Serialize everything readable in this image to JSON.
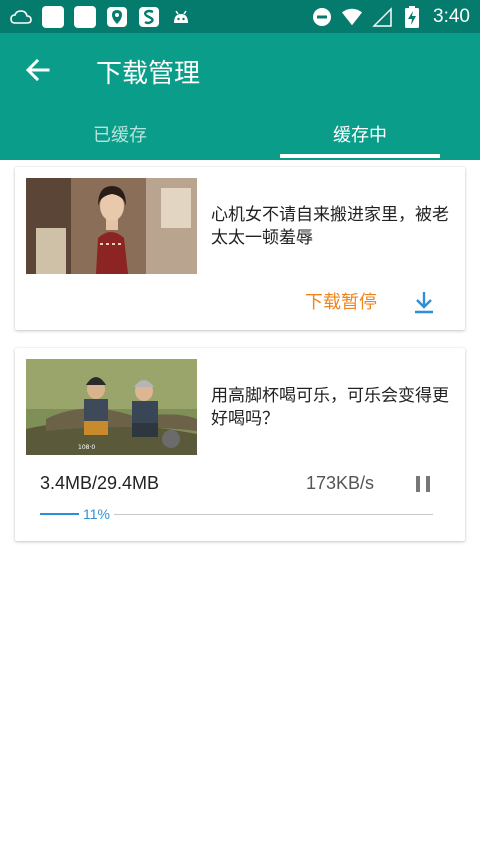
{
  "statusbar": {
    "left_icons": [
      "cloud-icon",
      "app-square-icon",
      "app-square-icon",
      "map-pin-icon",
      "sogou-s-icon",
      "android-icon"
    ],
    "right_icons": [
      "do-not-disturb-icon",
      "wifi-icon",
      "signal-icon",
      "battery-charging-icon"
    ],
    "time": "3:40"
  },
  "appbar": {
    "title": "下载管理",
    "colors": {
      "statusbar": "#047b6d",
      "appbar": "#0a9e8a"
    }
  },
  "tabs": [
    {
      "label": "已缓存",
      "active": false
    },
    {
      "label": "缓存中",
      "active": true
    }
  ],
  "downloads": [
    {
      "title": "心机女不请自来搬进家里，被老太太一顿羞辱",
      "status": "下载暂停",
      "status_color": "#f0851e",
      "action_icon": "download-icon"
    },
    {
      "title": "用高脚杯喝可乐，可乐会变得更好喝吗？",
      "size": "3.4MB/29.4MB",
      "speed": "173KB/s",
      "progress": 0.11,
      "progress_label": "11%",
      "action_icon": "pause-icon"
    }
  ]
}
